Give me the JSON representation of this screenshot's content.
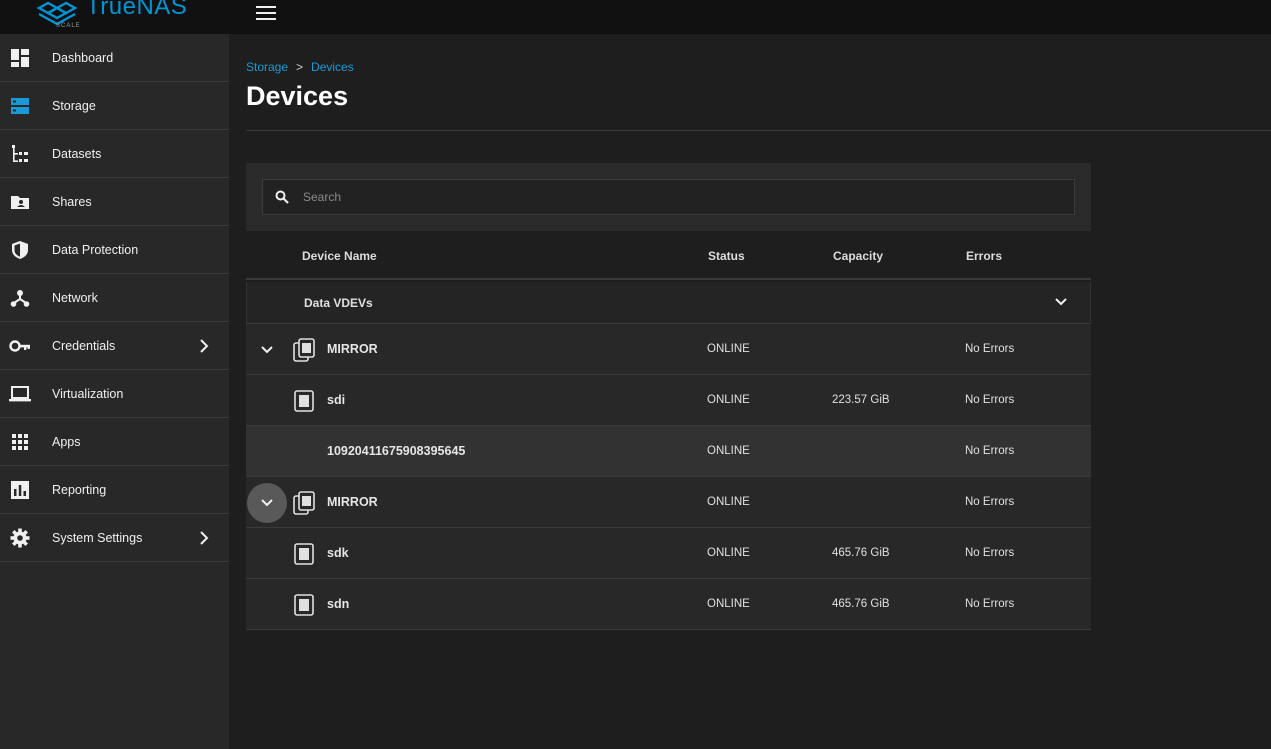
{
  "app": {
    "logo_text": "TrueNAS",
    "logo_sub": "SCALE",
    "accent": "#0095d5"
  },
  "sidebar": {
    "items": [
      {
        "label": "Dashboard",
        "icon": "dashboard-icon"
      },
      {
        "label": "Storage",
        "icon": "storage-icon",
        "active": true
      },
      {
        "label": "Datasets",
        "icon": "datasets-icon"
      },
      {
        "label": "Shares",
        "icon": "shares-icon"
      },
      {
        "label": "Data Protection",
        "icon": "shield-icon"
      },
      {
        "label": "Network",
        "icon": "network-icon"
      },
      {
        "label": "Credentials",
        "icon": "key-icon",
        "submenu": true
      },
      {
        "label": "Virtualization",
        "icon": "laptop-icon"
      },
      {
        "label": "Apps",
        "icon": "apps-grid-icon"
      },
      {
        "label": "Reporting",
        "icon": "bar-chart-icon"
      },
      {
        "label": "System Settings",
        "icon": "gear-icon",
        "submenu": true
      }
    ]
  },
  "breadcrumb": {
    "items": [
      "Storage",
      "Devices"
    ],
    "separator": ">"
  },
  "page": {
    "title": "Devices"
  },
  "search": {
    "placeholder": "Search",
    "value": ""
  },
  "table": {
    "columns": [
      "Device Name",
      "Status",
      "Capacity",
      "Errors"
    ],
    "group": {
      "label": "Data VDEVs"
    },
    "rows": [
      {
        "name": "MIRROR",
        "status": "ONLINE",
        "capacity": "",
        "errors": "No Errors",
        "type": "mirror"
      },
      {
        "name": "sdi",
        "status": "ONLINE",
        "capacity": "223.57 GiB",
        "errors": "No Errors",
        "type": "disk"
      },
      {
        "name": "10920411675908395645",
        "status": "ONLINE",
        "capacity": "",
        "errors": "No Errors",
        "type": "missing"
      },
      {
        "name": "MIRROR",
        "status": "ONLINE",
        "capacity": "",
        "errors": "No Errors",
        "type": "mirror"
      },
      {
        "name": "sdk",
        "status": "ONLINE",
        "capacity": "465.76 GiB",
        "errors": "No Errors",
        "type": "disk"
      },
      {
        "name": "sdn",
        "status": "ONLINE",
        "capacity": "465.76 GiB",
        "errors": "No Errors",
        "type": "disk"
      }
    ]
  }
}
